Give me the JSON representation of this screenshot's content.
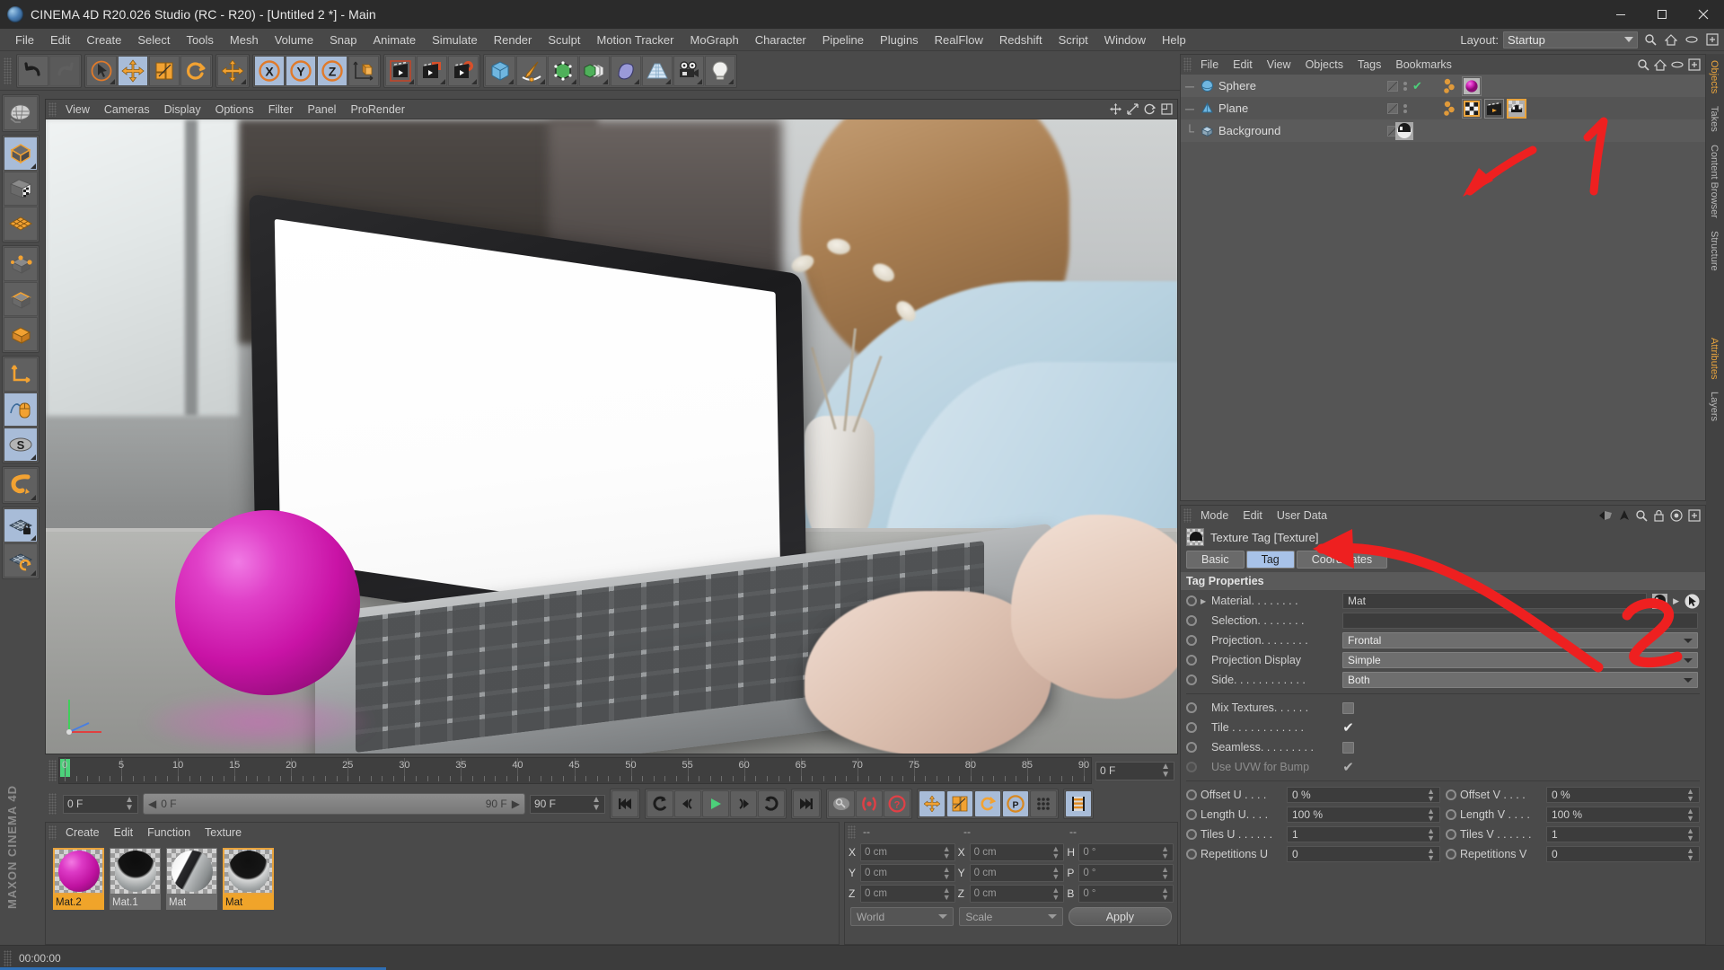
{
  "window": {
    "title": "CINEMA 4D R20.026 Studio (RC - R20) - [Untitled 2 *] - Main",
    "minimize_label": "Minimize",
    "maximize_label": "Maximize",
    "close_label": "Close"
  },
  "menubar": {
    "items": [
      "File",
      "Edit",
      "Create",
      "Select",
      "Tools",
      "Mesh",
      "Volume",
      "Snap",
      "Animate",
      "Simulate",
      "Render",
      "Sculpt",
      "Motion Tracker",
      "MoGraph",
      "Character",
      "Pipeline",
      "Plugins",
      "RealFlow",
      "Redshift",
      "Script",
      "Window",
      "Help"
    ],
    "layout_label": "Layout:",
    "layout_value": "Startup",
    "search_icon": "search-icon",
    "home_icon": "home-icon",
    "eye_icon": "eye-icon",
    "expand_icon": "expand-icon"
  },
  "toolbar": {
    "groups": [
      {
        "name": "history",
        "buttons": [
          {
            "name": "undo-button",
            "icon": "undo-icon",
            "state": "normal"
          },
          {
            "name": "redo-button",
            "icon": "redo-icon",
            "state": "disabled"
          }
        ]
      },
      {
        "name": "transform",
        "buttons": [
          {
            "name": "live-selection-button",
            "icon": "cursor-icon",
            "state": "normal"
          },
          {
            "name": "move-button",
            "icon": "move-icon",
            "state": "active"
          },
          {
            "name": "scale-button",
            "icon": "scale-icon",
            "state": "normal"
          },
          {
            "name": "rotate-button",
            "icon": "rotate-icon",
            "state": "normal"
          }
        ]
      },
      {
        "name": "move-solo",
        "buttons": [
          {
            "name": "move-alt-button",
            "icon": "move-icon",
            "state": "normal"
          }
        ]
      },
      {
        "name": "axis-lock",
        "buttons": [
          {
            "name": "x-axis-button",
            "icon": "x-icon",
            "state": "active"
          },
          {
            "name": "y-axis-button",
            "icon": "y-icon",
            "state": "active"
          },
          {
            "name": "z-axis-button",
            "icon": "z-icon",
            "state": "active"
          },
          {
            "name": "world-coordinate-button",
            "icon": "world-axis-icon",
            "state": "normal"
          }
        ]
      },
      {
        "name": "render",
        "buttons": [
          {
            "name": "render-view-button",
            "icon": "clapper-icon",
            "state": "normal"
          },
          {
            "name": "render-to-picture-viewer-button",
            "icon": "clapper-picture-icon",
            "state": "normal"
          },
          {
            "name": "render-settings-button",
            "icon": "clapper-gear-icon",
            "state": "normal"
          }
        ]
      },
      {
        "name": "create",
        "buttons": [
          {
            "name": "add-cube-button",
            "icon": "cube-icon",
            "state": "normal"
          },
          {
            "name": "add-spline-button",
            "icon": "pen-icon",
            "state": "normal"
          },
          {
            "name": "add-nurbs-button",
            "icon": "nurbs-icon",
            "state": "normal"
          },
          {
            "name": "add-array-button",
            "icon": "array-icon",
            "state": "normal"
          },
          {
            "name": "add-deformer-button",
            "icon": "deformer-icon",
            "state": "normal"
          },
          {
            "name": "add-floor-button",
            "icon": "floor-icon",
            "state": "normal"
          },
          {
            "name": "add-camera-button",
            "icon": "camera-icon",
            "state": "normal"
          },
          {
            "name": "add-light-button",
            "icon": "light-icon",
            "state": "normal"
          }
        ]
      }
    ]
  },
  "leftbar": {
    "buttons": [
      {
        "name": "make-editable-button",
        "icon": "make-editable-icon",
        "state": "normal"
      },
      {
        "name": "model-mode-button",
        "icon": "model-mode-icon",
        "state": "active"
      },
      {
        "name": "texture-mode-button",
        "icon": "texture-mode-icon",
        "state": "normal"
      },
      {
        "name": "uv-mode-button",
        "icon": "uv-mode-icon",
        "state": "normal"
      },
      {
        "name": "points-mode-button",
        "icon": "points-mode-icon",
        "state": "normal"
      },
      {
        "name": "edges-mode-button",
        "icon": "edges-mode-icon",
        "state": "normal"
      },
      {
        "name": "polygons-mode-button",
        "icon": "polygons-mode-icon",
        "state": "normal"
      },
      {
        "name": "object-axis-button",
        "icon": "axis-icon",
        "state": "normal"
      },
      {
        "name": "enable-snapping-button",
        "icon": "mouse-snap-icon",
        "state": "active"
      },
      {
        "name": "soft-selection-button",
        "icon": "soft-selection-icon",
        "state": "active"
      },
      {
        "name": "magnet-button",
        "icon": "magnet-icon",
        "state": "normal"
      },
      {
        "name": "workplane-lock-button",
        "icon": "workplane-lock-icon",
        "state": "active"
      },
      {
        "name": "workplane-rotate-button",
        "icon": "workplane-rotate-icon",
        "state": "normal"
      }
    ],
    "brand_line1": "MAXON",
    "brand_line2": "CINEMA 4D"
  },
  "viewport": {
    "menus": [
      "View",
      "Cameras",
      "Display",
      "Options",
      "Filter",
      "Panel",
      "ProRender"
    ],
    "icons": [
      "move-view-icon",
      "scale-view-icon",
      "rotate-view-icon",
      "maximize-view-icon"
    ]
  },
  "timeline": {
    "ticks": [
      0,
      5,
      10,
      15,
      20,
      25,
      30,
      35,
      40,
      45,
      50,
      55,
      60,
      65,
      70,
      75,
      80,
      85,
      90
    ],
    "current_frame_label": "0 F",
    "playhead_frame": 0,
    "range_start": "0 F",
    "range_end": "90 F",
    "end_frame_field": "90 F",
    "start_frame_field": "0 F",
    "transport_buttons": [
      {
        "name": "go-to-start-button",
        "icon": "skip-start-icon"
      },
      {
        "name": "previous-key-button",
        "icon": "prev-key-icon"
      },
      {
        "name": "step-back-button",
        "icon": "step-back-icon"
      },
      {
        "name": "play-button",
        "icon": "play-icon"
      },
      {
        "name": "step-forward-button",
        "icon": "step-forward-icon"
      },
      {
        "name": "next-key-button",
        "icon": "next-key-icon"
      },
      {
        "name": "go-to-end-button",
        "icon": "skip-end-icon"
      },
      {
        "name": "record-active-objects-button",
        "icon": "key-icon"
      },
      {
        "name": "autokeying-button",
        "icon": "autokey-icon"
      },
      {
        "name": "keyframe-selection-button",
        "icon": "question-icon"
      },
      {
        "name": "record-position-button",
        "icon": "position-icon"
      },
      {
        "name": "record-scale-button",
        "icon": "scale-key-icon"
      },
      {
        "name": "record-rotation-button",
        "icon": "rotation-key-icon"
      },
      {
        "name": "record-pla-button",
        "icon": "pla-icon"
      },
      {
        "name": "record-parameter-button",
        "icon": "param-icon"
      },
      {
        "name": "timeline-view-button",
        "icon": "timeline-icon"
      }
    ]
  },
  "material_manager": {
    "menus": [
      "Create",
      "Edit",
      "Function",
      "Texture"
    ],
    "materials": [
      {
        "name": "Mat.2",
        "selected": true,
        "color": "#d825b8"
      },
      {
        "name": "Mat.1",
        "selected": false,
        "color": "#cfcfcf"
      },
      {
        "name": "Mat",
        "selected": false,
        "color": "#dddddd"
      },
      {
        "name": "Mat",
        "selected": true,
        "color": "#cfcfcf"
      }
    ]
  },
  "coordinates": {
    "header_dashes": [
      "--",
      "--",
      "--"
    ],
    "rows": [
      {
        "labels": [
          "X",
          "X",
          "H"
        ],
        "values": [
          "0 cm",
          "0 cm",
          "0 °"
        ]
      },
      {
        "labels": [
          "Y",
          "Y",
          "P"
        ],
        "values": [
          "0 cm",
          "0 cm",
          "0 °"
        ]
      },
      {
        "labels": [
          "Z",
          "Z",
          "B"
        ],
        "values": [
          "0 cm",
          "0 cm",
          "0 °"
        ]
      }
    ],
    "coord_system": "World",
    "size_mode": "Scale",
    "apply_label": "Apply"
  },
  "object_manager": {
    "menus": [
      "File",
      "Edit",
      "View",
      "Objects",
      "Tags",
      "Bookmarks"
    ],
    "icons": [
      "search-icon",
      "home-icon",
      "eye-icon",
      "expand-icon"
    ],
    "objects": [
      {
        "name": "Sphere",
        "icon": "sphere-icon",
        "visible_check": true,
        "tags": [
          {
            "name": "material-tag",
            "icon": "material-tag-icon",
            "selected": false
          }
        ]
      },
      {
        "name": "Plane",
        "icon": "plane-icon",
        "visible_check": false,
        "tags": [
          {
            "name": "checker-tag",
            "icon": "checker-tag-icon",
            "selected": false
          },
          {
            "name": "animation-tag",
            "icon": "animation-tag-icon",
            "selected": false
          },
          {
            "name": "texture-tag",
            "icon": "texture-tag-icon",
            "selected": true
          }
        ]
      },
      {
        "name": "Background",
        "icon": "background-icon",
        "visible_check": false,
        "tags": [
          {
            "name": "background-material-tag",
            "icon": "bg-material-tag-icon",
            "selected": false
          }
        ]
      }
    ]
  },
  "attribute_manager": {
    "menus": [
      "Mode",
      "Edit",
      "User Data"
    ],
    "icons": [
      "back-arrow-icon",
      "up-arrow-icon",
      "search-icon",
      "lock-icon",
      "target-icon",
      "expand-icon"
    ],
    "title": "Texture Tag [Texture]",
    "tabs": [
      {
        "label": "Basic",
        "active": false
      },
      {
        "label": "Tag",
        "active": true
      },
      {
        "label": "Coordinates",
        "active": false
      }
    ],
    "section_title": "Tag Properties",
    "fields": [
      {
        "name": "material-field",
        "label": "Material. . . . . . . .",
        "type": "text",
        "value": "Mat",
        "has_arrow": true
      },
      {
        "name": "selection-field",
        "label": "Selection. . . . . . . .",
        "type": "text",
        "value": ""
      },
      {
        "name": "projection-field",
        "label": "Projection. . . . . . . .",
        "type": "select",
        "value": "Frontal"
      },
      {
        "name": "projection-display-field",
        "label": "Projection Display",
        "type": "select",
        "value": "Simple"
      },
      {
        "name": "side-field",
        "label": "Side. . . . . . . . . . . .",
        "type": "select",
        "value": "Both"
      }
    ],
    "checks": [
      {
        "name": "mix-textures-check",
        "label": "Mix Textures. . . . . .",
        "checked": false,
        "dim": false
      },
      {
        "name": "tile-check",
        "label": "Tile  . . . . . . . . . . . .",
        "checked": true,
        "dim": false
      },
      {
        "name": "seamless-check",
        "label": "Seamless. . . . . . . . .",
        "checked": false,
        "dim": false
      },
      {
        "name": "use-uvw-for-bump-check",
        "label": "Use UVW for Bump",
        "checked": true,
        "dim": true
      }
    ],
    "uv_fields": [
      {
        "name": "offset-u-field",
        "label": "Offset U . . . .",
        "value": "0 %"
      },
      {
        "name": "offset-v-field",
        "label": "Offset V . . . .",
        "value": "0 %"
      },
      {
        "name": "length-u-field",
        "label": "Length U. . . .",
        "value": "100 %"
      },
      {
        "name": "length-v-field",
        "label": "Length V . . . .",
        "value": "100 %"
      },
      {
        "name": "tiles-u-field",
        "label": "Tiles U . . . . . .",
        "value": "1"
      },
      {
        "name": "tiles-v-field",
        "label": "Tiles V . . . . . .",
        "value": "1"
      },
      {
        "name": "repetitions-u-field",
        "label": "Repetitions U",
        "value": "0"
      },
      {
        "name": "repetitions-v-field",
        "label": "Repetitions V",
        "value": "0"
      }
    ]
  },
  "right_tabs": [
    {
      "label": "Objects",
      "active": true
    },
    {
      "label": "Takes",
      "active": false
    },
    {
      "label": "Content Browser",
      "active": false
    },
    {
      "label": "Structure",
      "active": false
    },
    {
      "label": "Attributes",
      "active": true
    },
    {
      "label": "Layers",
      "active": false
    }
  ],
  "statusbar": {
    "time": "00:00:00"
  },
  "annotations": [
    {
      "name": "annotation-arrow-1",
      "label": "1",
      "color": "#ee2020"
    },
    {
      "name": "annotation-arrow-2",
      "label": "2",
      "color": "#ee2020"
    }
  ],
  "colors": {
    "accent_orange": "#e8a33d",
    "accent_blue": "#a8c2e8",
    "sphere_magenta": "#d825b8",
    "annotation_red": "#ee2020",
    "panel_bg": "#4a4a4a"
  }
}
